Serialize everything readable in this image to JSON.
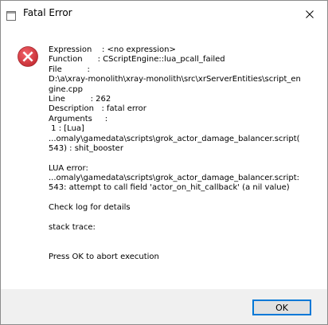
{
  "window": {
    "title": "Fatal Error"
  },
  "message": {
    "lines": [
      "Expression    : <no expression>",
      "Function      : CScriptEngine::lua_pcall_failed",
      "File          :",
      "D:\\a\\xray-monolith\\xray-monolith\\src\\xrServerEntities\\script_en",
      "gine.cpp",
      "Line          : 262",
      "Description   : fatal error",
      "Arguments     :",
      " 1 : [Lua]",
      "...omaly\\gamedata\\scripts\\grok_actor_damage_balancer.script(",
      "543) : shit_booster",
      "",
      "LUA error:",
      "...omaly\\gamedata\\scripts\\grok_actor_damage_balancer.script:",
      "543: attempt to call field 'actor_on_hit_callback' (a nil value)",
      "",
      "Check log for details",
      "",
      "stack trace:",
      "",
      "",
      "Press OK to abort execution"
    ]
  },
  "buttons": {
    "ok_label": "OK"
  },
  "icons": {
    "title_icon": "app-window-icon",
    "close_icon": "close-icon",
    "error_icon": "error-x-icon",
    "error_color": "#d13438"
  }
}
